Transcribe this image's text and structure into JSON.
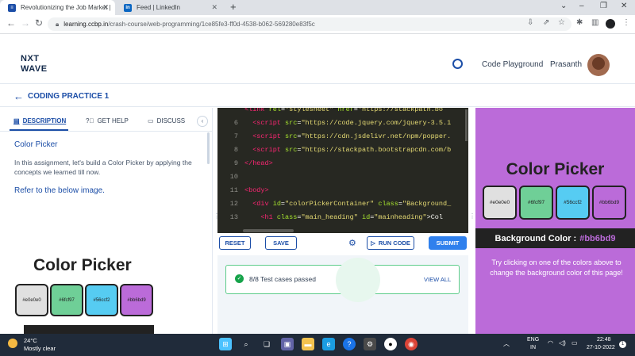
{
  "browser": {
    "tabs": [
      {
        "title": "Revolutionizing the Job Market |",
        "favicon": "nxtwave-icon"
      },
      {
        "title": "Feed | LinkedIn",
        "favicon": "linkedin-icon"
      }
    ],
    "new_tab": "+",
    "url_host": "learning.ccbp.in",
    "url_path": "/crash-course/web-programming/1ce85fe3-ff0d-4538-b062-569280e83f5c"
  },
  "header": {
    "logo_line1": "NXT",
    "logo_line2": "WAVE",
    "playground_label": "Code Playground",
    "user_name": "Prasanth"
  },
  "practice": {
    "title": "CODING PRACTICE 1"
  },
  "left_panel": {
    "tabs": [
      "DESCRIPTION",
      "GET HELP",
      "DISCUSS"
    ],
    "collapse": "‹",
    "heading": "Color Picker",
    "body": "In this assignment, let's build a Color Picker by applying the concepts we learned till now.",
    "refer": "Refer to the below image.",
    "preview_title": "Color Picker",
    "swatches": [
      "#e0e0e0",
      "#6fcf97",
      "#56ccf2",
      "#bb6bd9"
    ]
  },
  "editor": {
    "lines": [
      {
        "n": "",
        "html": "<span class='tag'>&lt;link</span> <span class='att'>rel</span>=<span class='str'>\"stylesheet\"</span> <span class='att'>href</span>=<span class='str'>\"https://stackpath.bo</span>"
      },
      {
        "n": "6",
        "html": "  <span class='tag'>&lt;script</span> <span class='att'>src</span>=<span class='str'>\"https://code.jquery.com/jquery-3.5.1</span>"
      },
      {
        "n": "7",
        "html": "  <span class='tag'>&lt;script</span> <span class='att'>src</span>=<span class='str'>\"https://cdn.jsdelivr.net/npm/popper.</span>"
      },
      {
        "n": "8",
        "html": "  <span class='tag'>&lt;script</span> <span class='att'>src</span>=<span class='str'>\"https://stackpath.bootstrapcdn.com/b</span>"
      },
      {
        "n": "9",
        "html": "<span class='tag'>&lt;/head&gt;</span>"
      },
      {
        "n": "10",
        "html": ""
      },
      {
        "n": "11",
        "html": "<span class='tag'>&lt;body&gt;</span>"
      },
      {
        "n": "12",
        "html": "  <span class='tag'>&lt;div</span> <span class='att'>id</span>=<span class='str'>\"colorPickerContainer\"</span> <span class='att'>class</span>=<span class='str'>\"Background_</span>"
      },
      {
        "n": "13",
        "html": "    <span class='tag'>&lt;h1</span> <span class='att'>class</span>=<span class='str'>\"main_heading\"</span> <span class='att'>id</span>=<span class='str'>\"mainheading\"</span>&gt;Col"
      }
    ],
    "buttons": {
      "reset": "RESET",
      "save": "SAVE",
      "run": "RUN CODE",
      "submit": "SUBMIT"
    }
  },
  "tests": {
    "status": "8/8 Test cases passed",
    "view_all": "VIEW ALL"
  },
  "preview": {
    "title": "Color Picker",
    "swatches": [
      "#e0e0e0",
      "#6fcf97",
      "#56ccf2",
      "#bb6bd9"
    ],
    "bg_label": "Background Color :",
    "bg_value": "#bb6bd9",
    "info": "Try clicking on one of the colors above to change the background color of this page!",
    "bg_color": "#bb6bd9"
  },
  "taskbar": {
    "temp": "24°C",
    "weather": "Mostly clear",
    "lang1": "ENG",
    "lang2": "IN",
    "time": "22:48",
    "date": "27-10-2022"
  }
}
